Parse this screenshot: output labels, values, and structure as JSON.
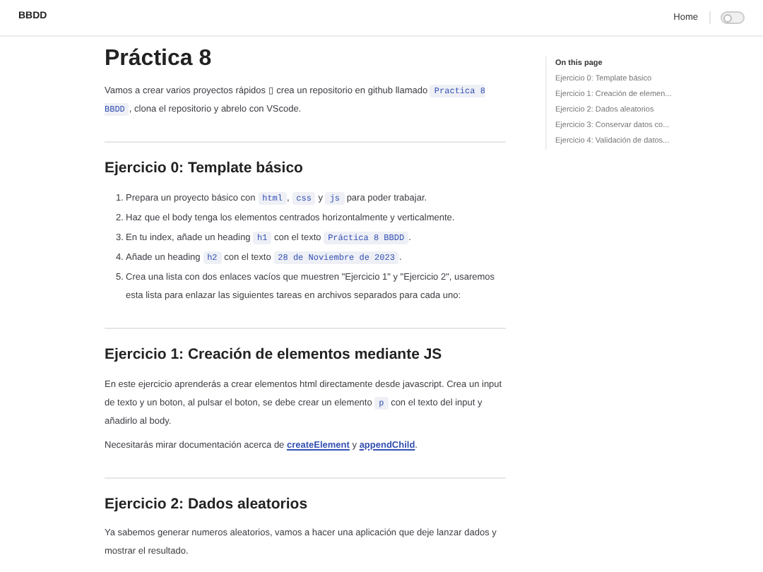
{
  "nav": {
    "brand": "BBDD",
    "links": [
      "Home"
    ],
    "theme_toggle": {
      "on": false
    }
  },
  "page": {
    "title": "Práctica 8",
    "intro": [
      {
        "kind": "text",
        "text": "Vamos a crear varios proyectos rápidos ▯ crea un repositorio en github llamado "
      },
      {
        "kind": "code",
        "text": "Practica 8 BBDD"
      },
      {
        "kind": "text",
        "text": ", clona el repositorio y abrelo con VScode."
      }
    ],
    "sections": [
      {
        "heading": "Ejercicio 0: Template básico",
        "list": [
          {
            "marker": "1.",
            "segments": [
              {
                "kind": "text",
                "text": "Prepara un proyecto básico con "
              },
              {
                "kind": "code",
                "text": "html"
              },
              {
                "kind": "text",
                "text": ", "
              },
              {
                "kind": "code",
                "text": "css"
              },
              {
                "kind": "text",
                "text": " y "
              },
              {
                "kind": "code",
                "text": "js"
              },
              {
                "kind": "text",
                "text": " para poder trabajar."
              }
            ]
          },
          {
            "marker": "2.",
            "segments": [
              {
                "kind": "text",
                "text": "Haz que el body tenga los elementos centrados horizontalmente y verticalmente."
              }
            ]
          },
          {
            "marker": "3.",
            "segments": [
              {
                "kind": "text",
                "text": "En tu index, añade un heading "
              },
              {
                "kind": "code",
                "text": "h1"
              },
              {
                "kind": "text",
                "text": " con el texto "
              },
              {
                "kind": "code",
                "text": "Práctica 8 BBDD"
              },
              {
                "kind": "text",
                "text": "."
              }
            ]
          },
          {
            "marker": "4.",
            "segments": [
              {
                "kind": "text",
                "text": "Añade un heading "
              },
              {
                "kind": "code",
                "text": "h2"
              },
              {
                "kind": "text",
                "text": " con el texto "
              },
              {
                "kind": "code",
                "text": "28 de Noviembre de 2023"
              },
              {
                "kind": "text",
                "text": "."
              }
            ]
          },
          {
            "marker": "5.",
            "segments": [
              {
                "kind": "text",
                "text": "Crea una lista con dos enlaces vacíos que muestren \"Ejercicio 1\" y \"Ejercicio 2\", usaremos esta lista para enlazar las siguientes tareas en archivos separados para cada uno:"
              }
            ]
          }
        ]
      },
      {
        "heading": "Ejercicio 1: Creación de elementos mediante JS",
        "paragraphs": [
          [
            {
              "kind": "text",
              "text": "En este ejercicio aprenderás a crear elementos html directamente desde javascript. Crea un input de texto y un boton, al pulsar el boton, se debe crear un elemento "
            },
            {
              "kind": "code",
              "text": "p"
            },
            {
              "kind": "text",
              "text": " con el texto del input y añadirlo al body."
            }
          ],
          [
            {
              "kind": "text",
              "text": "Necesitarás mirar documentación acerca de "
            },
            {
              "kind": "link",
              "text": "createElement"
            },
            {
              "kind": "text",
              "text": " y "
            },
            {
              "kind": "link",
              "text": "appendChild"
            },
            {
              "kind": "text",
              "text": "."
            }
          ]
        ]
      },
      {
        "heading": "Ejercicio 2: Dados aleatorios",
        "paragraphs": [
          [
            {
              "kind": "text",
              "text": "Ya sabemos generar numeros aleatorios, vamos a hacer una aplicación que deje lanzar dados y mostrar el resultado."
            }
          ]
        ]
      }
    ]
  },
  "outline": {
    "title": "On this page",
    "items": [
      "Ejercicio 0: Template básico",
      "Ejercicio 1: Creación de elemen...",
      "Ejercicio 2: Dados aleatorios",
      "Ejercicio 3: Conservar datos co...",
      "Ejercicio 4: Validación de datos..."
    ]
  }
}
